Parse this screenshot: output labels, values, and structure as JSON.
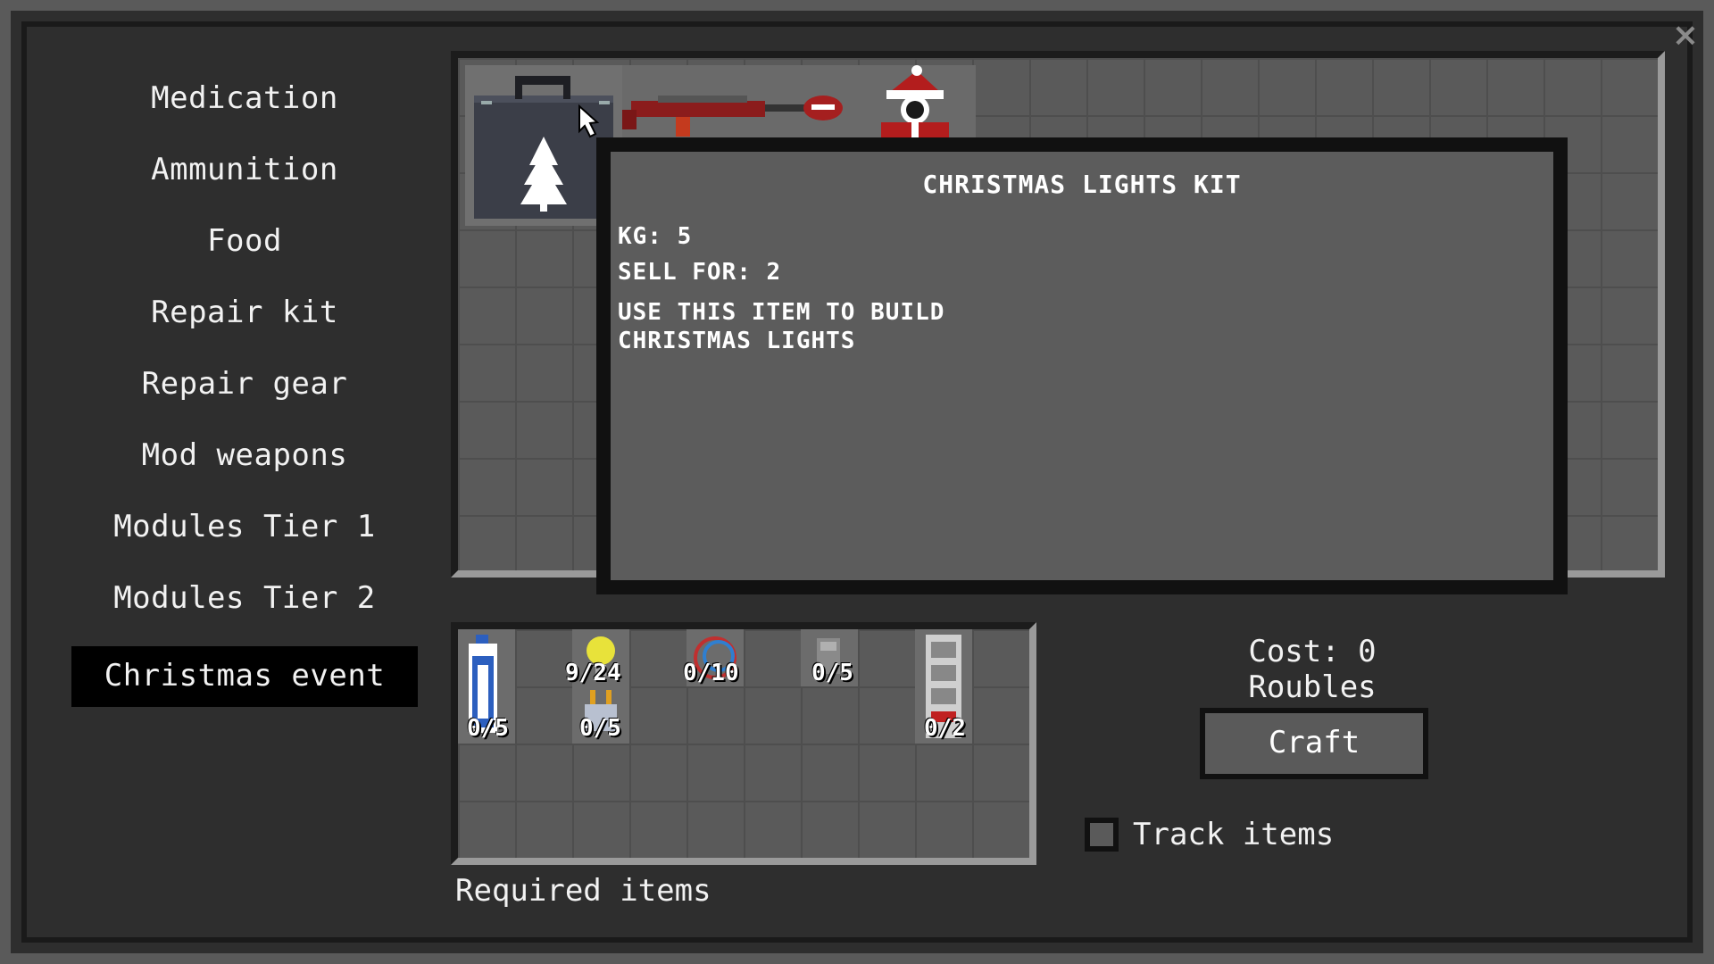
{
  "close_icon": "×",
  "sidebar": {
    "items": [
      {
        "label": "Medication"
      },
      {
        "label": "Ammunition"
      },
      {
        "label": "Food"
      },
      {
        "label": "Repair kit"
      },
      {
        "label": "Repair gear"
      },
      {
        "label": "Mod weapons"
      },
      {
        "label": "Modules Tier 1"
      },
      {
        "label": "Modules Tier 2"
      },
      {
        "label": "Christmas event"
      }
    ],
    "active_index": 8
  },
  "recipes": [
    {
      "icon": "christmas-lights-kit-icon"
    },
    {
      "icon": "red-rifle-icon"
    },
    {
      "icon": "santa-suit-icon"
    }
  ],
  "tooltip": {
    "title": "CHRISTMAS LIGHTS KIT",
    "weight": "KG: 5",
    "sell": "SELL FOR: 2",
    "description_line1": "USE THIS ITEM TO BUILD",
    "description_line2": "CHRISTMAS LIGHTS"
  },
  "required": {
    "label": "Required items",
    "items": [
      {
        "icon": "water-bottle-icon",
        "count": "0/5"
      },
      {
        "icon": "light-bulb-icon",
        "count": "9/24"
      },
      {
        "icon": "plug-icon",
        "count": "0/5"
      },
      {
        "icon": "wire-coil-icon",
        "count": "0/10"
      },
      {
        "icon": "tape-icon",
        "count": "0/5"
      },
      {
        "icon": "server-rack-icon",
        "count": "0/2"
      }
    ]
  },
  "cost": "Cost: 0 Roubles",
  "craft_label": "Craft",
  "track_label": "Track items",
  "colors": {
    "background": "#2e2e2e",
    "slot": "#5a5a5a",
    "active": "#000000"
  }
}
